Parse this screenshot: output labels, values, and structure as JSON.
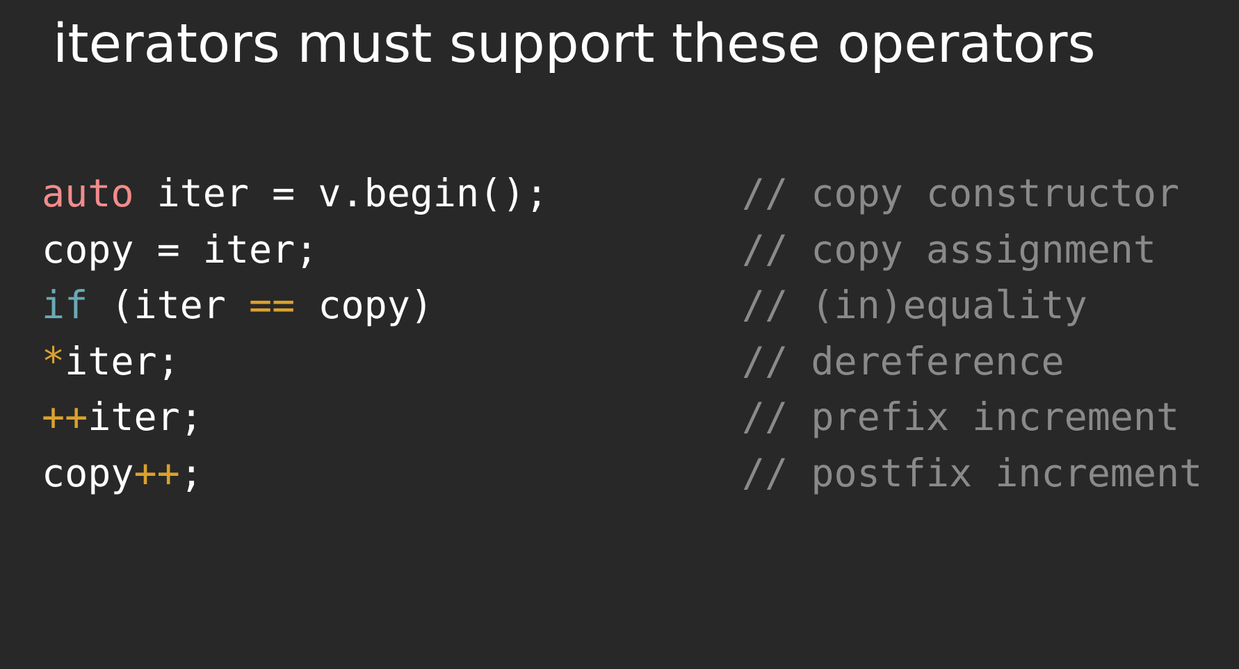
{
  "title": "iterators must support these operators",
  "colors": {
    "background": "#282828",
    "text": "#ffffff",
    "comment": "#8a8a8a",
    "keyword_auto": "#f28c8c",
    "keyword_if": "#6aa9b6",
    "operator": "#dba12e"
  },
  "code_lines": [
    {
      "tokens": [
        {
          "text": "auto",
          "kind": "keyword-red"
        },
        {
          "text": " iter = v.begin();",
          "kind": "plain"
        }
      ],
      "comment": "// copy constructor"
    },
    {
      "tokens": [
        {
          "text": "copy = iter;",
          "kind": "plain"
        }
      ],
      "comment": "// copy assignment"
    },
    {
      "tokens": [
        {
          "text": "if",
          "kind": "keyword-teal"
        },
        {
          "text": " (iter ",
          "kind": "plain"
        },
        {
          "text": "==",
          "kind": "operator"
        },
        {
          "text": " copy)",
          "kind": "plain"
        }
      ],
      "comment": "// (in)equality"
    },
    {
      "tokens": [
        {
          "text": "*",
          "kind": "operator"
        },
        {
          "text": "iter;",
          "kind": "plain"
        }
      ],
      "comment": "// dereference"
    },
    {
      "tokens": [
        {
          "text": "++",
          "kind": "operator"
        },
        {
          "text": "iter;",
          "kind": "plain"
        }
      ],
      "comment": "// prefix increment"
    },
    {
      "tokens": [
        {
          "text": "copy",
          "kind": "plain"
        },
        {
          "text": "++",
          "kind": "operator"
        },
        {
          "text": ";",
          "kind": "plain"
        }
      ],
      "comment": "// postfix increment"
    }
  ]
}
